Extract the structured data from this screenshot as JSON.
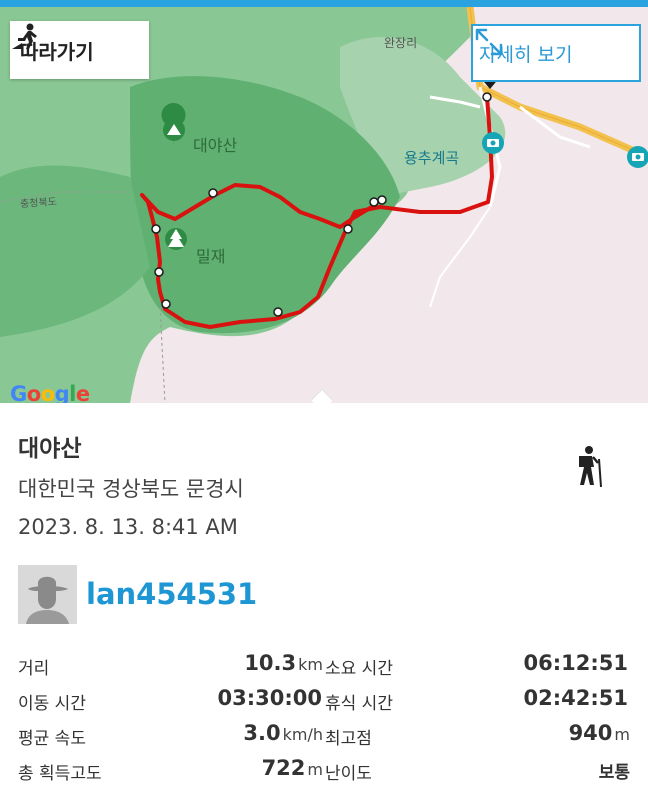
{
  "map": {
    "follow_button": "따라가기",
    "detail_button": "자세히 보기",
    "labels": {
      "wanjangri": "완장리",
      "daeyasan": "대야산",
      "yongchu": "용추계곡",
      "miljae": "밀재",
      "road": "충청북도"
    },
    "google": "Google",
    "colors": {
      "route": "#d9120f",
      "forest": "#5fb071",
      "accent": "#29a3e0",
      "road": "#f3c14e"
    }
  },
  "summary": {
    "title": "대야산",
    "region": "대한민국 경상북도 문경시",
    "datetime": "2023. 8. 13. 8:41 AM",
    "activity_icon": "hiking-icon",
    "username": "lan454531"
  },
  "stats": {
    "distance_label": "거리",
    "distance_value": "10.3",
    "distance_unit": "km",
    "total_time_label": "소요 시간",
    "total_time_value": "06:12:51",
    "moving_time_label": "이동 시간",
    "moving_time_value": "03:30:00",
    "rest_time_label": "휴식 시간",
    "rest_time_value": "02:42:51",
    "avg_speed_label": "평균 속도",
    "avg_speed_value": "3.0",
    "avg_speed_unit": "km/h",
    "max_alt_label": "최고점",
    "max_alt_value": "940",
    "max_alt_unit": "m",
    "gain_label": "총 획득고도",
    "gain_value": "722",
    "gain_unit": "m",
    "difficulty_label": "난이도",
    "difficulty_value": "보통"
  }
}
